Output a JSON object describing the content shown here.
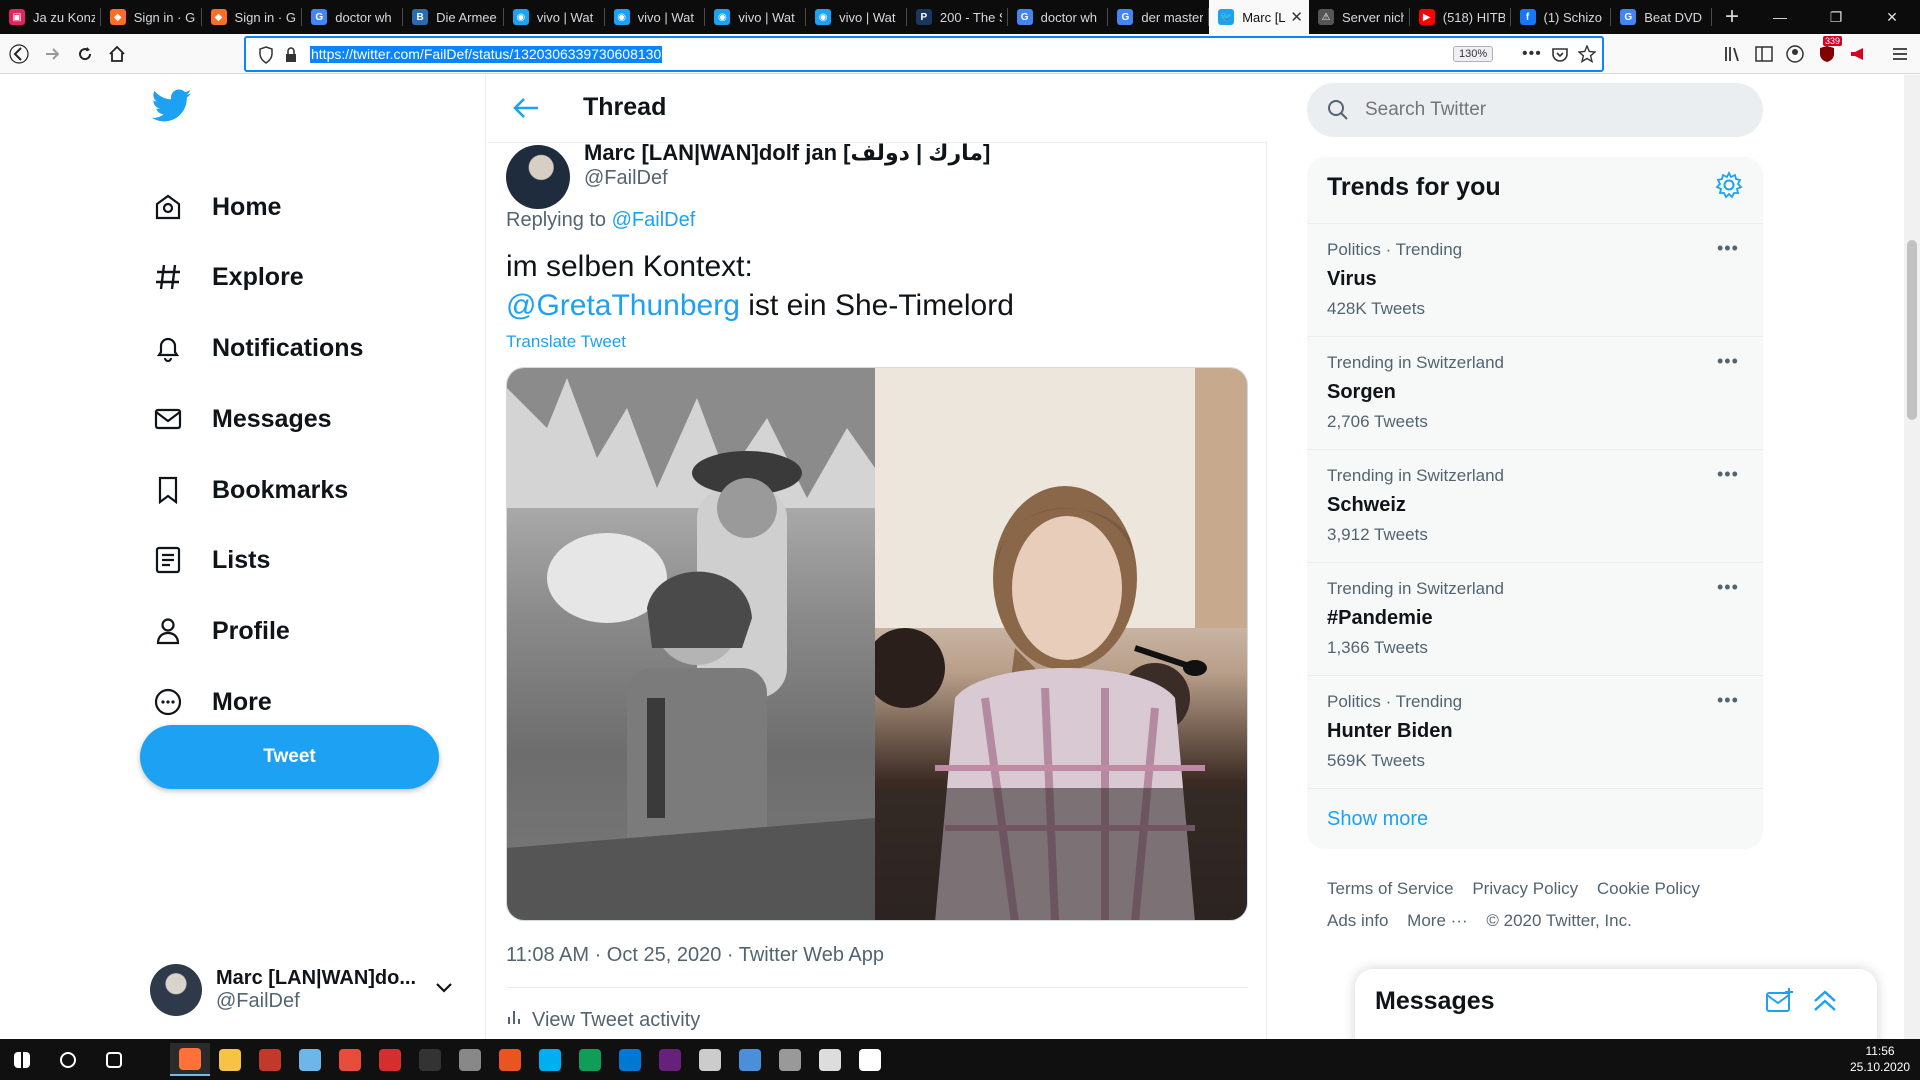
{
  "browser": {
    "tabs": [
      {
        "title": "Ja zu Konze",
        "color": "#e0245e",
        "glyph": "▣"
      },
      {
        "title": "Sign in · Gi",
        "color": "#fc6d26",
        "glyph": "◆"
      },
      {
        "title": "Sign in · Gi",
        "color": "#fc6d26",
        "glyph": "◆"
      },
      {
        "title": "doctor wh",
        "color": "#4285f4",
        "glyph": "G"
      },
      {
        "title": "Die Armee",
        "color": "#2b6cb0",
        "glyph": "B"
      },
      {
        "title": "vivo | Wat",
        "color": "#1da1f2",
        "glyph": "◉"
      },
      {
        "title": "vivo | Wat",
        "color": "#1da1f2",
        "glyph": "◉"
      },
      {
        "title": "vivo | Wat",
        "color": "#1da1f2",
        "glyph": "◉"
      },
      {
        "title": "vivo | Wat",
        "color": "#1da1f2",
        "glyph": "◉"
      },
      {
        "title": "200 - The S",
        "color": "#1a365d",
        "glyph": "P"
      },
      {
        "title": "doctor wh",
        "color": "#4285f4",
        "glyph": "G"
      },
      {
        "title": "der master",
        "color": "#4285f4",
        "glyph": "G"
      },
      {
        "title": "Marc [L",
        "color": "#1da1f2",
        "glyph": "🐦"
      },
      {
        "title": "Server nich",
        "color": "#555555",
        "glyph": "⚠"
      },
      {
        "title": "(518) HITB",
        "color": "#ff0000",
        "glyph": "▶"
      },
      {
        "title": "(1) Schizo",
        "color": "#1877f2",
        "glyph": "f"
      },
      {
        "title": "Beat DVD",
        "color": "#4285f4",
        "glyph": "G"
      }
    ],
    "active_tab_index": 12,
    "url": "https://twitter.com/FailDef/status/1320306339730608130",
    "zoom": "130%",
    "badge": "339"
  },
  "nav": {
    "items": [
      {
        "key": "home",
        "label": "Home"
      },
      {
        "key": "explore",
        "label": "Explore"
      },
      {
        "key": "notifications",
        "label": "Notifications"
      },
      {
        "key": "messages",
        "label": "Messages"
      },
      {
        "key": "bookmarks",
        "label": "Bookmarks"
      },
      {
        "key": "lists",
        "label": "Lists"
      },
      {
        "key": "profile",
        "label": "Profile"
      },
      {
        "key": "more",
        "label": "More"
      }
    ],
    "tweet_button": "Tweet",
    "account": {
      "name": "Marc [LAN|WAN]do...",
      "handle": "@FailDef"
    }
  },
  "thread": {
    "header_title": "Thread",
    "author_name": "Marc [LAN|WAN]dolf jan [مارك | دولف]",
    "author_handle": "@FailDef",
    "replying_prefix": "Replying to ",
    "replying_to": "@FailDef",
    "text_line1": "im selben Kontext:",
    "mention": "@GretaThunberg",
    "text_line2_rest": " ist ein She-Timelord",
    "translate": "Translate Tweet",
    "meta": "11:08 AM · Oct 25, 2020 · Twitter Web App",
    "activity": "View Tweet activity"
  },
  "sidebar": {
    "search_placeholder": "Search Twitter",
    "trends_title": "Trends for you",
    "trends": [
      {
        "context": "Politics · Trending",
        "title": "Virus",
        "count": "428K Tweets"
      },
      {
        "context": "Trending in Switzerland",
        "title": "Sorgen",
        "count": "2,706 Tweets"
      },
      {
        "context": "Trending in Switzerland",
        "title": "Schweiz",
        "count": "3,912 Tweets"
      },
      {
        "context": "Trending in Switzerland",
        "title": "#Pandemie",
        "count": "1,366 Tweets"
      },
      {
        "context": "Politics · Trending",
        "title": "Hunter Biden",
        "count": "569K Tweets"
      }
    ],
    "show_more": "Show more",
    "footer": [
      "Terms of Service",
      "Privacy Policy",
      "Cookie Policy",
      "Ads info",
      "More ···",
      "© 2020 Twitter, Inc."
    ],
    "messages_title": "Messages"
  },
  "taskbar": {
    "time": "11:56",
    "date": "25.10.2020",
    "apps": [
      {
        "name": "windows",
        "color": "#ffffff"
      },
      {
        "name": "search",
        "color": "#ffffff"
      },
      {
        "name": "task-view",
        "color": "#ffffff"
      },
      {
        "name": "firefox",
        "color": "#ff7139"
      },
      {
        "name": "explorer",
        "color": "#f6c344"
      },
      {
        "name": "voicemeeter",
        "color": "#c0392b"
      },
      {
        "name": "app-blue",
        "color": "#6db6e8"
      },
      {
        "name": "app-red",
        "color": "#e74c3c"
      },
      {
        "name": "app-hex",
        "color": "#d32f2f"
      },
      {
        "name": "live",
        "color": "#333333"
      },
      {
        "name": "app-gray",
        "color": "#888888"
      },
      {
        "name": "ubuntu",
        "color": "#e95420"
      },
      {
        "name": "skype",
        "color": "#00aff0"
      },
      {
        "name": "edge",
        "color": "#0f9d58"
      },
      {
        "name": "outlook",
        "color": "#0078d4"
      },
      {
        "name": "visual-studio",
        "color": "#68217a"
      },
      {
        "name": "app-x",
        "color": "#cccccc"
      },
      {
        "name": "app-arrows",
        "color": "#4a90d9"
      },
      {
        "name": "app-box",
        "color": "#999999"
      },
      {
        "name": "app-diamond",
        "color": "#dddddd"
      },
      {
        "name": "app-window",
        "color": "#ffffff"
      }
    ]
  },
  "colors": {
    "accent": "#1da1f2",
    "text": "#0f1419",
    "muted": "#536471"
  }
}
